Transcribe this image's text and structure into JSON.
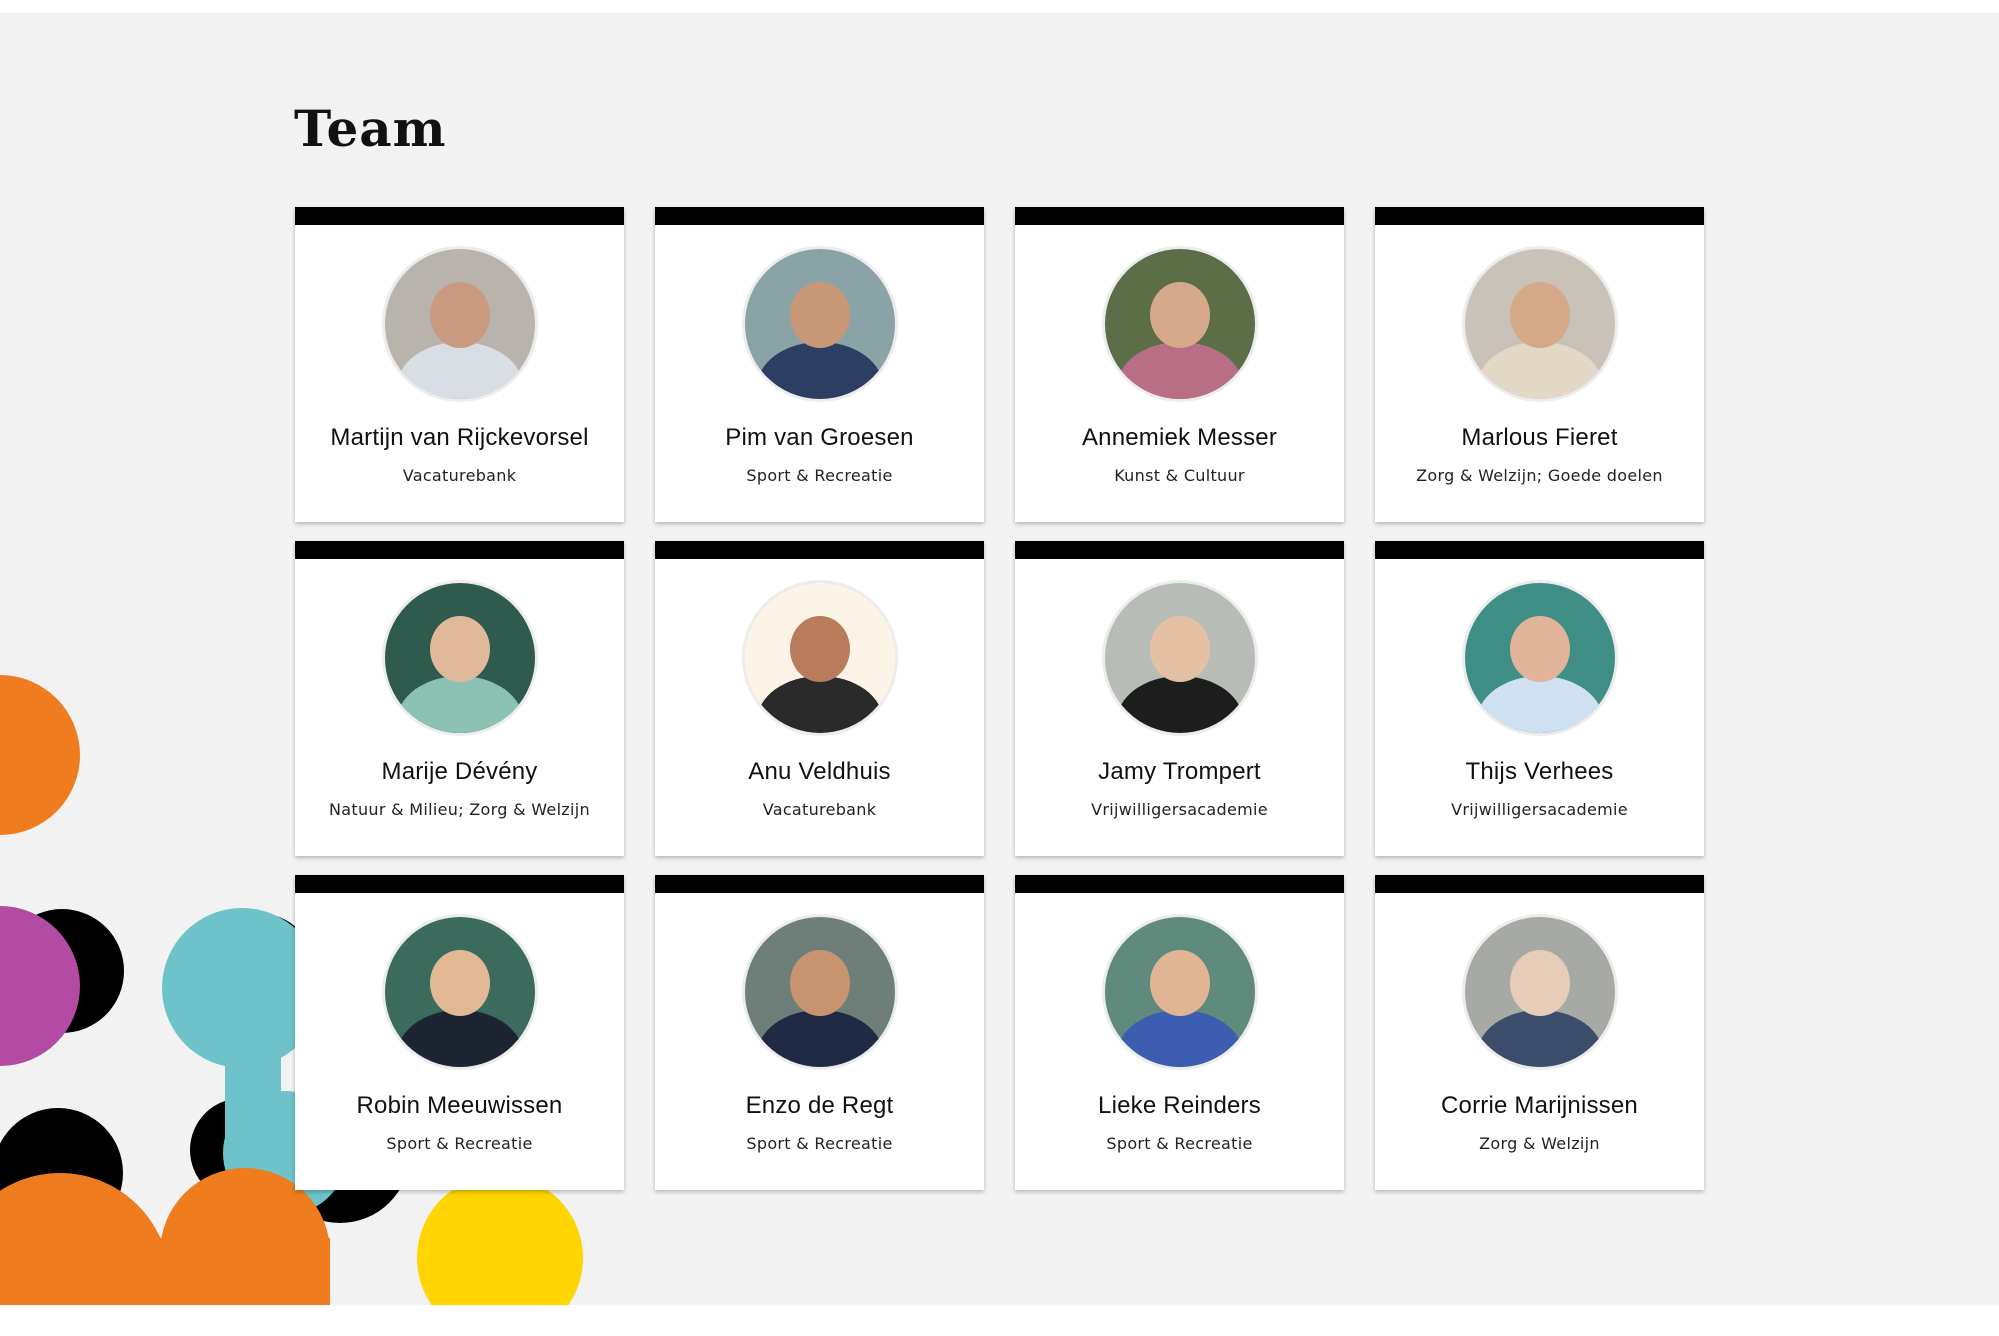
{
  "page": {
    "title": "Team"
  },
  "colors": {
    "background": "#f2f2f2",
    "card_top_bar": "#000000",
    "blob_orange": "#ef7d1f",
    "blob_purple": "#b34aa4",
    "blob_teal": "#6dc3c9",
    "blob_black": "#000000",
    "blob_yellow": "#ffd400"
  },
  "team": [
    {
      "name": "Martijn van Rijckevorsel",
      "sector": "Vacaturebank"
    },
    {
      "name": "Pim van Groesen",
      "sector": "Sport & Recreatie"
    },
    {
      "name": "Annemiek Messer",
      "sector": "Kunst & Cultuur"
    },
    {
      "name": "Marlous Fieret",
      "sector": "Zorg & Welzijn; Goede doelen"
    },
    {
      "name": "Marije Dévény",
      "sector": "Natuur & Milieu; Zorg & Welzijn"
    },
    {
      "name": "Anu Veldhuis",
      "sector": "Vacaturebank"
    },
    {
      "name": "Jamy Trompert",
      "sector": "Vrijwilligersacademie"
    },
    {
      "name": "Thijs Verhees",
      "sector": "Vrijwilligersacademie"
    },
    {
      "name": "Robin Meeuwissen",
      "sector": "Sport & Recreatie"
    },
    {
      "name": "Enzo de Regt",
      "sector": "Sport & Recreatie"
    },
    {
      "name": "Lieke Reinders",
      "sector": "Sport & Recreatie"
    },
    {
      "name": "Corrie Marijnissen",
      "sector": "Zorg & Welzijn"
    }
  ]
}
